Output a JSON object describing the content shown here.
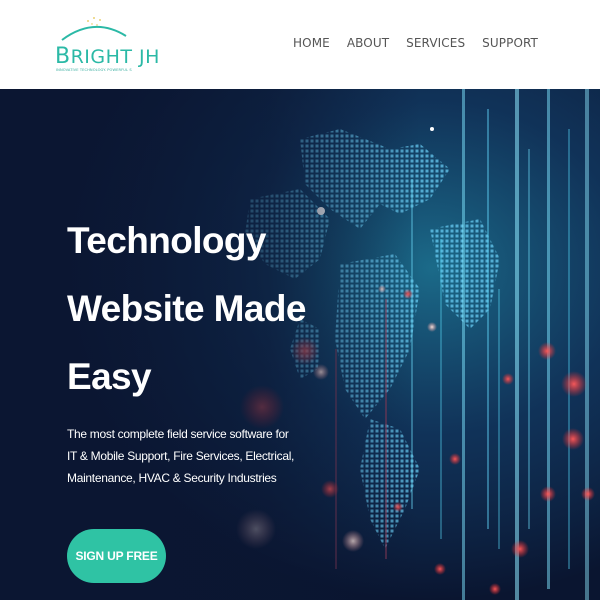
{
  "brand": {
    "logo_main": "BRIGHT JH",
    "logo_big_letter": "B",
    "logo_rest": "RIGHT JH",
    "logo_tagline": "INNOVATIVE TECHNOLOGY. POWERFUL SOLUTIONS",
    "accent_color": "#2bb9a6"
  },
  "nav": {
    "items": [
      {
        "label": "HOME"
      },
      {
        "label": "ABOUT"
      },
      {
        "label": "SERVICES"
      },
      {
        "label": "SUPPORT"
      }
    ]
  },
  "hero": {
    "title_lines": [
      "Technology",
      "Website Made",
      "Easy"
    ],
    "description": "The most complete field service software for IT & Mobile Support, Fire Services, Electrical, Maintenance, HVAC & Security Industries",
    "cta_label": "SIGN UP FREE",
    "cta_color": "#2fc3a4",
    "background_theme": "digital-world-map-with-glowing-data-lines"
  }
}
